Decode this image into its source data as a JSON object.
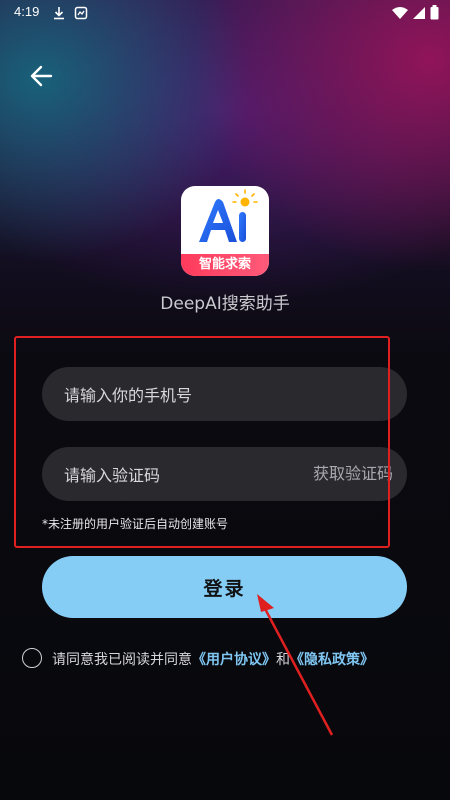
{
  "status_bar": {
    "time": "4:19",
    "left_icons": [
      "download-icon",
      "notification-icon"
    ],
    "right_icons": [
      "wifi-icon",
      "signal-icon",
      "battery-icon"
    ]
  },
  "header": {
    "back_icon": "arrow-left-icon"
  },
  "app": {
    "logo_text": "智能求索",
    "logo_letters": "Ai",
    "name": "DeepAI搜索助手"
  },
  "form": {
    "phone_placeholder": "请输入你的手机号",
    "code_placeholder": "请输入验证码",
    "get_code_label": "获取验证码",
    "hint": "*未注册的用户验证后自动创建账号"
  },
  "login": {
    "label": "登录"
  },
  "agreement": {
    "prefix": "请同意我已阅读并同意",
    "user_agreement": "《用户协议》",
    "and": "和",
    "privacy_policy": "《隐私政策》"
  },
  "colors": {
    "accent": "#86cdf6",
    "link": "#7fc6f2",
    "annotation_red": "#e02020",
    "input_bg": "#2a2a2e"
  }
}
